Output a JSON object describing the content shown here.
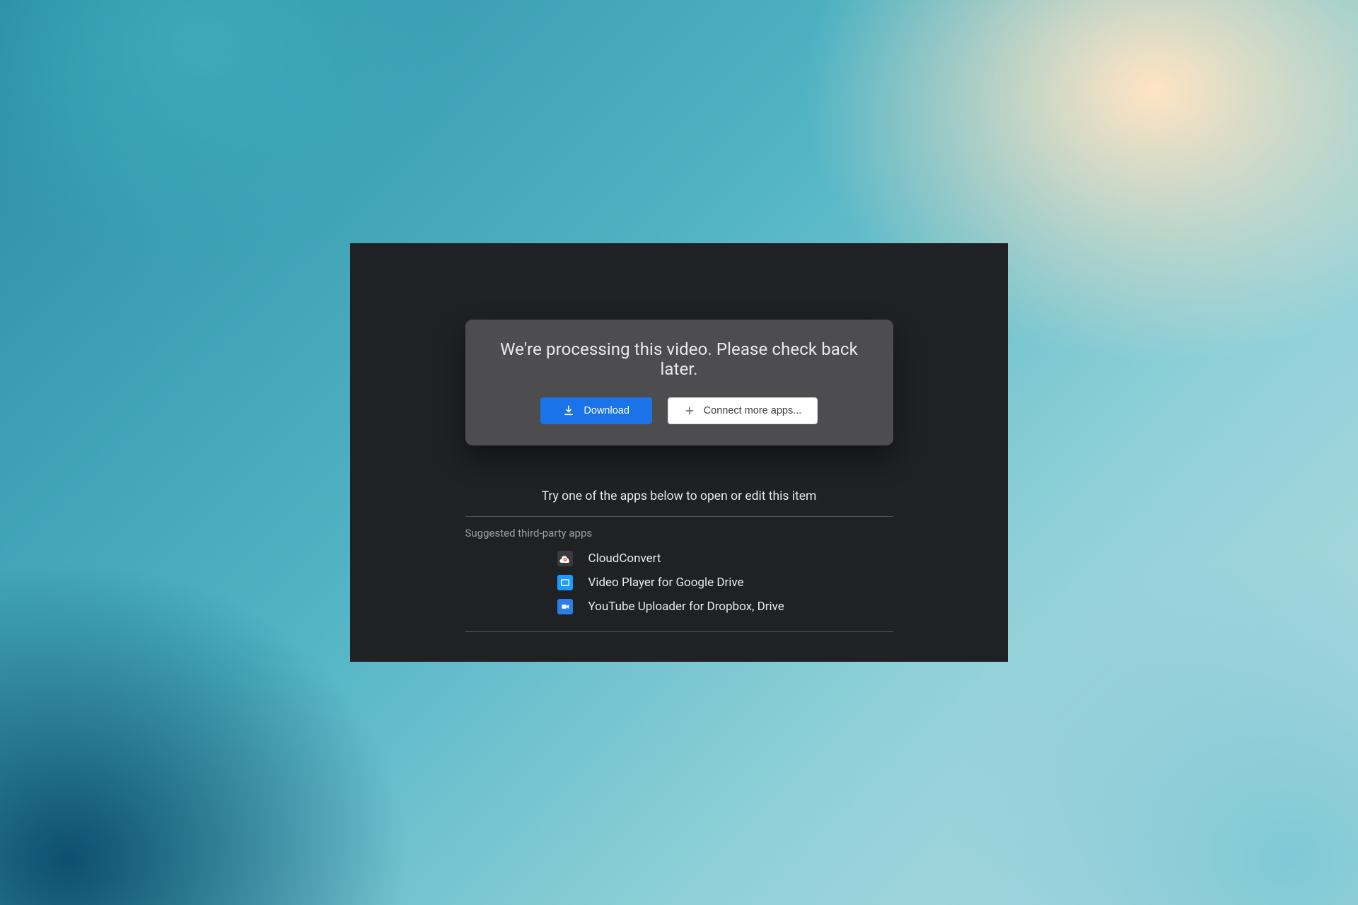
{
  "card": {
    "message": "We're processing this video. Please check back later.",
    "download_label": "Download",
    "connect_label": "Connect more apps..."
  },
  "subhead": "Try one of the apps below to open or edit this item",
  "section_label": "Suggested third-party apps",
  "apps": [
    {
      "name": "CloudConvert",
      "icon": "cloud"
    },
    {
      "name": "Video Player for Google Drive",
      "icon": "video"
    },
    {
      "name": "YouTube Uploader for Dropbox, Drive",
      "icon": "uploader"
    }
  ]
}
